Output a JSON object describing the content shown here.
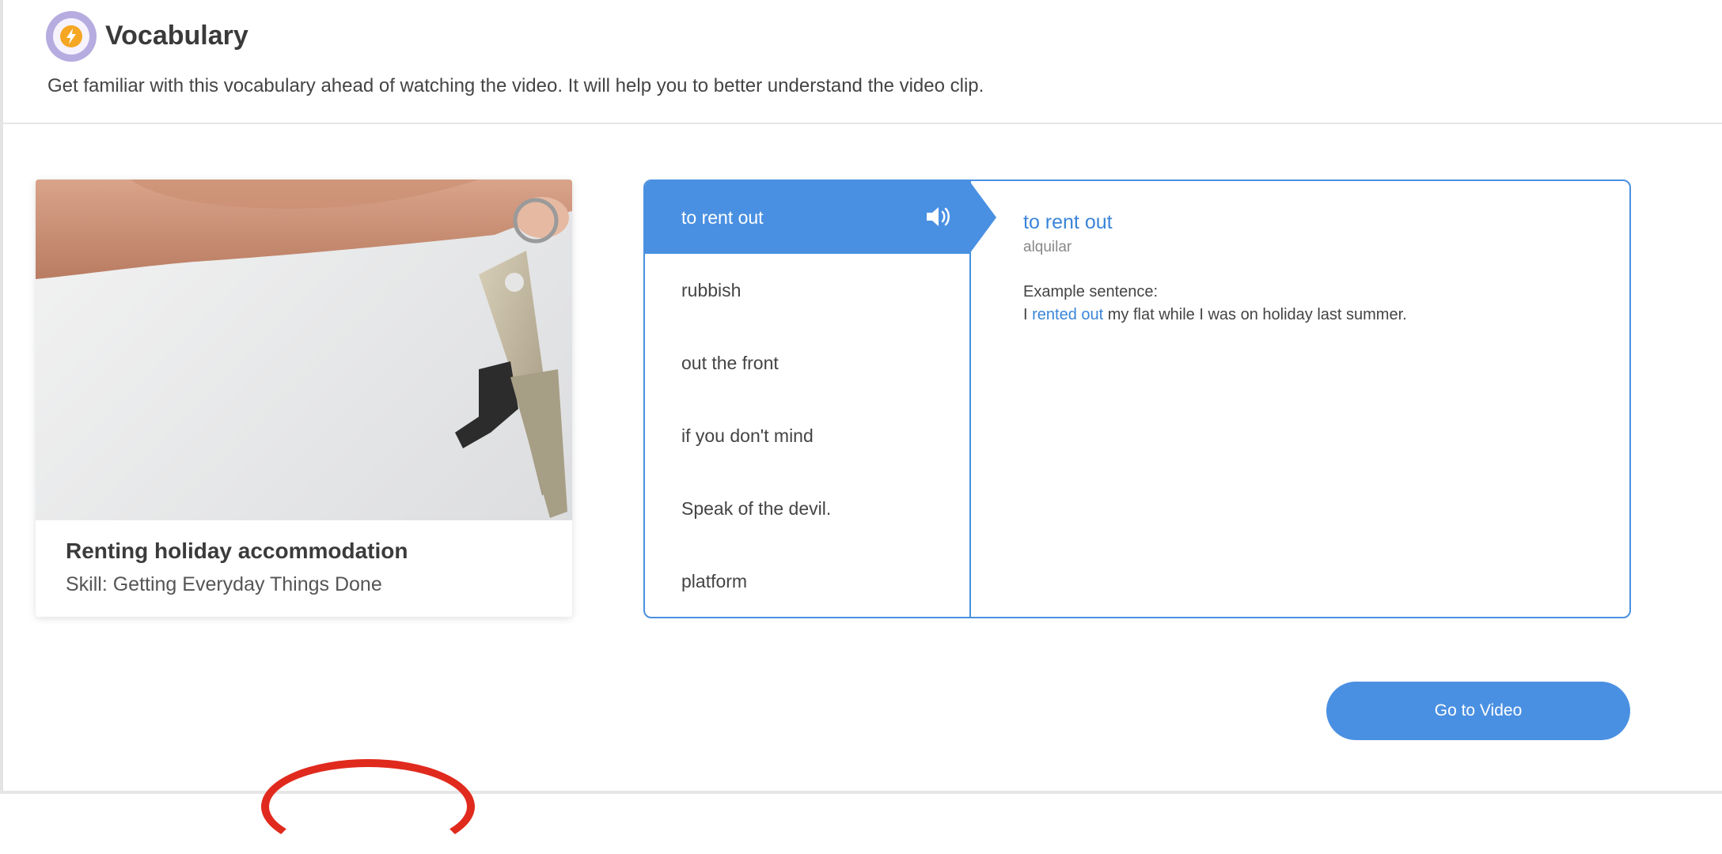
{
  "header": {
    "title": "Vocabulary",
    "description": "Get familiar with this vocabulary ahead of watching the video. It will help you to better understand the video clip.",
    "icon": "lightning-icon",
    "icon_color": "#f0a030"
  },
  "card": {
    "image": "keys-photo",
    "title": "Renting holiday accommodation",
    "skill": "Skill: Getting Everyday Things Done"
  },
  "vocab": {
    "items": [
      {
        "label": "to rent out"
      },
      {
        "label": "rubbish"
      },
      {
        "label": "out the front"
      },
      {
        "label": "if you don't mind"
      },
      {
        "label": "Speak of the devil."
      },
      {
        "label": "platform"
      }
    ],
    "active_index": 0,
    "detail": {
      "term": "to rent out",
      "translation": "alquilar",
      "example_label": "Example sentence:",
      "example_before": "I ",
      "example_highlight": "rented out",
      "example_after": " my flat while I was on holiday last summer."
    }
  },
  "go_button": {
    "label": "Go to Video"
  },
  "colors": {
    "accent": "#4a90e2",
    "highlight_text": "#3a85d8",
    "icon_ring": "#b7ace0",
    "annotation": "#e02a1e"
  }
}
